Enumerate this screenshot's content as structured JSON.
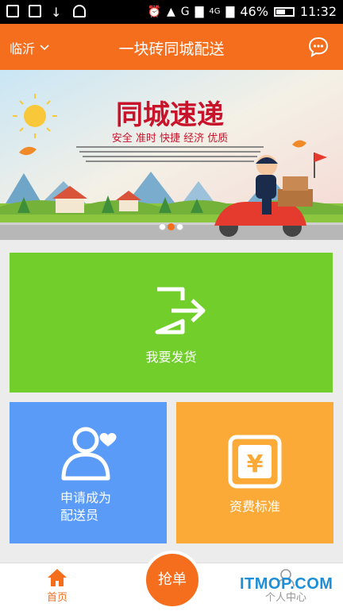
{
  "status_bar": {
    "battery": "46%",
    "time": "11:32",
    "network": "4G",
    "carrier_g": "G"
  },
  "header": {
    "city": "临沂",
    "title": "一块砖同城配送"
  },
  "banner": {
    "headline": "同城速递",
    "slogan": "安全 准时 快捷 经济 优质",
    "dot_count": 3,
    "active_index": 1
  },
  "tiles": {
    "ship": "我要发货",
    "apply_line1": "申请成为",
    "apply_line2": "配送员",
    "price": "资费标准"
  },
  "bottom_nav": {
    "home": "首页",
    "grab": "抢单",
    "me": "个人中心"
  },
  "watermark": "ITMOP.COM",
  "colors": {
    "brand": "#f56e1d",
    "green": "#72cf2b",
    "blue": "#5b9bf8",
    "yellow": "#fbaa37"
  }
}
